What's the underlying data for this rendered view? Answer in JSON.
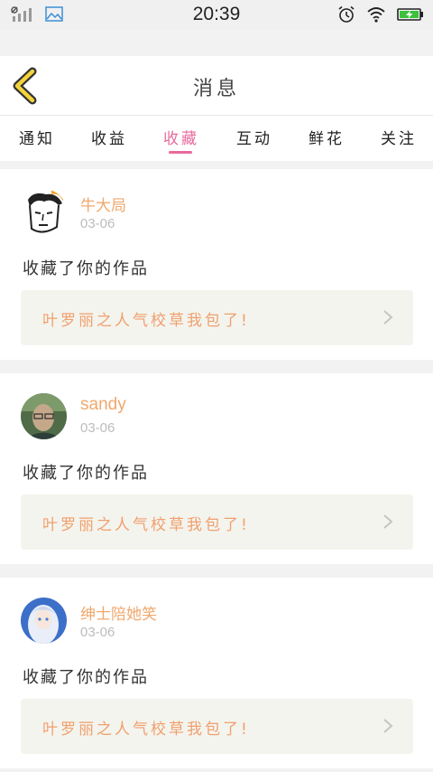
{
  "status_bar": {
    "time": "20:39",
    "icons": [
      "signal-icon",
      "image-icon",
      "alarm-icon",
      "wifi-icon",
      "battery-charging-icon"
    ]
  },
  "header": {
    "title": "消息",
    "back_icon": "chevron-left-icon"
  },
  "tabs": [
    {
      "label": "通知",
      "active": false
    },
    {
      "label": "收益",
      "active": false
    },
    {
      "label": "收藏",
      "active": true
    },
    {
      "label": "互动",
      "active": false
    },
    {
      "label": "鲜花",
      "active": false
    },
    {
      "label": "关注",
      "active": false
    }
  ],
  "colors": {
    "accent_pink": "#e86a9c",
    "username_orange": "#f0a86d",
    "work_title_orange": "#f0a06e",
    "back_icon_yellow": "#f2d33c"
  },
  "messages": [
    {
      "username": "牛大局",
      "date": "03-06",
      "action": "收藏了你的作品",
      "work_title": "叶罗丽之人气校草我包了!"
    },
    {
      "username": "sandy",
      "date": "03-06",
      "action": "收藏了你的作品",
      "work_title": "叶罗丽之人气校草我包了!"
    },
    {
      "username": "绅士陪她笑",
      "date": "03-06",
      "action": "收藏了你的作品",
      "work_title": "叶罗丽之人气校草我包了!"
    }
  ]
}
